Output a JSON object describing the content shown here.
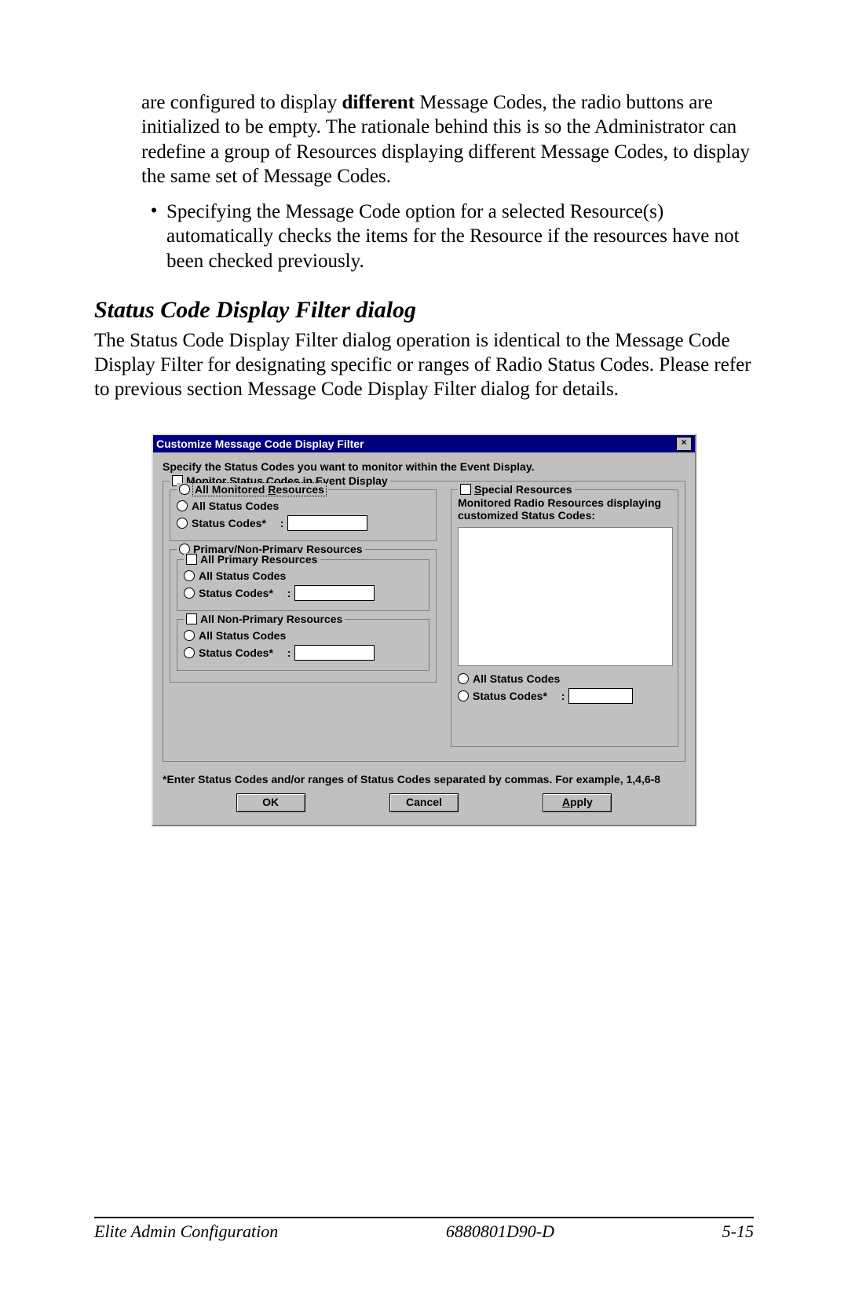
{
  "para1_pre": "are configured to display ",
  "para1_bold": "different",
  "para1_post": " Message Codes, the radio buttons are initialized to be empty.  The rationale behind this is so the Administrator can redefine a group of Resources displaying different Message Codes, to display the same set of Message Codes.",
  "bullet1": "Specifying the Message Code option for a selected Resource(s) automatically checks the items for the Resource if the resources have not been checked previously.",
  "heading": "Status Code Display Filter dialog",
  "para2": "The Status Code Display Filter dialog operation is identical to the Message Code Display Filter for designating specific or ranges of Radio Status Codes.  Please refer to previous section Message Code Display Filter dialog for details.",
  "dialog": {
    "title": "Customize Message Code Display Filter",
    "close": "×",
    "instruction": "Specify the Status Codes you want to monitor within the Event Display.",
    "monitor_group": "Monitor Status Codes in Event Display",
    "all_monitored": "All Monitored Resources",
    "all_status": "All Status Codes",
    "status_codes_lbl": "Status Codes*",
    "colon": ":",
    "pnp_group": "Primary/Non-Primary Resources",
    "all_primary": "All Primary Resources",
    "all_nonprimary": "All Non-Primary Resources",
    "special_group": "Special Resources",
    "special_desc": "Monitored Radio Resources displaying customized Status Codes:",
    "hint": "*Enter Status Codes and/or ranges of Status Codes separated by commas. For example, 1,4,6-8",
    "ok": "OK",
    "cancel": "Cancel",
    "apply": "Apply"
  },
  "footer": {
    "left": "Elite Admin Configuration",
    "center": "6880801D90-D",
    "right": "5-15"
  }
}
